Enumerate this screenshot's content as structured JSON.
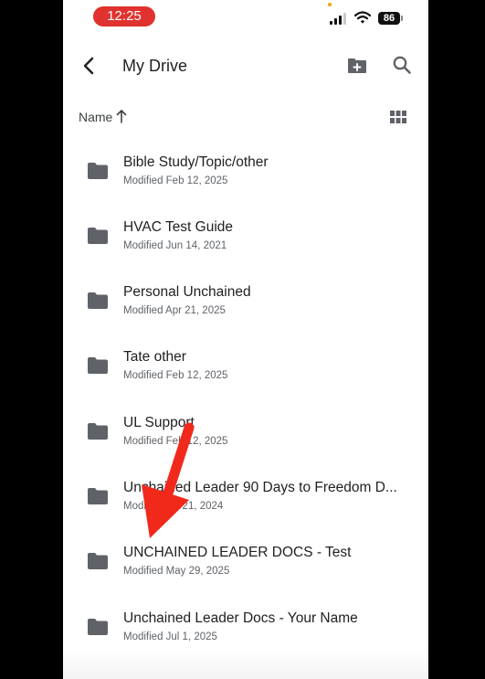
{
  "status_bar": {
    "time": "12:25",
    "battery": "86"
  },
  "app_bar": {
    "title": "My Drive"
  },
  "sort": {
    "label": "Name"
  },
  "files": [
    {
      "name": "Bible Study/Topic/other",
      "modified": "Modified Feb 12, 2025"
    },
    {
      "name": "HVAC Test Guide",
      "modified": "Modified Jun 14, 2021"
    },
    {
      "name": "Personal Unchained",
      "modified": "Modified Apr 21, 2025"
    },
    {
      "name": "Tate other",
      "modified": "Modified Feb 12, 2025"
    },
    {
      "name": "UL Support",
      "modified": "Modified Feb 12, 2025"
    },
    {
      "name": "Unchained Leader 90 Days to Freedom D...",
      "modified": "Modified Jul 21, 2024"
    },
    {
      "name": "UNCHAINED LEADER DOCS - Test",
      "modified": "Modified May 29, 2025"
    },
    {
      "name": "Unchained Leader Docs - Your Name",
      "modified": "Modified Jul 1, 2025"
    }
  ],
  "colors": {
    "annotation_arrow": "#f0291b",
    "time_pill": "#e0322e",
    "icon_gray": "#5f6368"
  },
  "icons": [
    "back-arrow-icon",
    "new-folder-icon",
    "search-icon",
    "sort-ascending-icon",
    "grid-view-icon",
    "folder-icon"
  ]
}
